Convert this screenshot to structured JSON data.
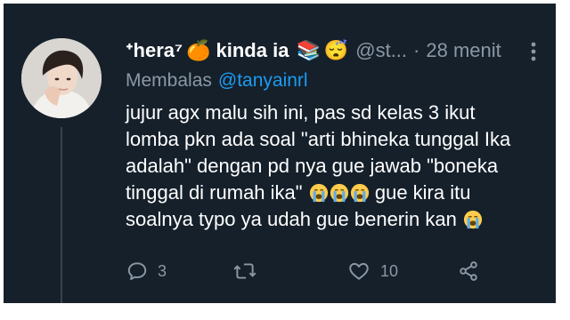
{
  "tweet": {
    "display_name": "ᕀhera⁷",
    "name_suffix": "kinda ia",
    "emoji_orange": "🍊",
    "emoji_books": "📚",
    "emoji_sleepy": "😴",
    "handle": "@st...",
    "separator": "·",
    "time": "28 menit",
    "replying_label": "Membalas",
    "replying_to": "@tanyainrl",
    "lines": [
      "jujur agx malu sih ini, pas sd kelas 3 ikut",
      "lomba pkn ada soal \"arti bhineka tunggal Ika",
      "adalah\" dengan pd nya gue jawab \"boneka",
      "tinggal di rumah ika\"",
      "gue kira itu",
      "soalnya typo ya udah gue benerin kan"
    ],
    "reply_count": "3",
    "like_count": "10"
  },
  "icons": {
    "avatar": "profile-photo",
    "more": "more-vertical-icon",
    "crying_emoji": "loudly-crying-face",
    "reply": "reply-bubble-icon",
    "retweet": "retweet-icon",
    "like": "heart-icon",
    "share": "share-icon"
  },
  "colors": {
    "background": "#15202b",
    "text": "#ffffff",
    "secondary": "#8b98a5",
    "link": "#1d9bf0",
    "thread_line": "#38444d"
  }
}
